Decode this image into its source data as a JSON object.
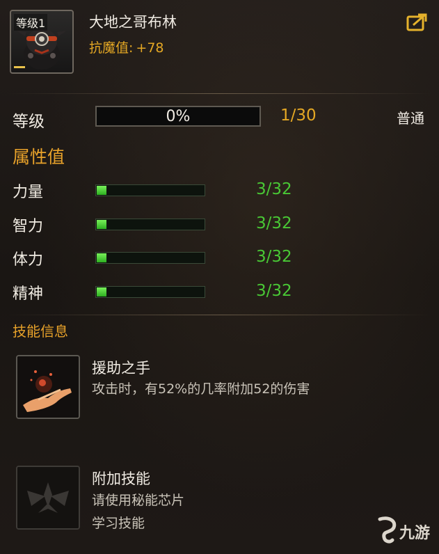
{
  "header": {
    "level_tag": "等级1",
    "name": "大地之哥布林",
    "stat_label": "抗魔值:",
    "stat_value": "+78"
  },
  "level": {
    "label": "等级",
    "progress_text": "0%",
    "progress_fraction": 0.0,
    "count": "1/30",
    "quality": "普通"
  },
  "attributes": {
    "title": "属性值",
    "items": [
      {
        "name": "力量",
        "value": "3/32",
        "fraction": 0.094
      },
      {
        "name": "智力",
        "value": "3/32",
        "fraction": 0.094
      },
      {
        "name": "体力",
        "value": "3/32",
        "fraction": 0.094
      },
      {
        "name": "精神",
        "value": "3/32",
        "fraction": 0.094
      }
    ]
  },
  "skills": {
    "title": "技能信息",
    "items": [
      {
        "name": "援助之手",
        "desc_line1": "攻击时，有52%的几率附加52的伤害",
        "icon": "helping-hand-icon"
      },
      {
        "name": "附加技能",
        "desc_line1": "请使用秘能芯片",
        "desc_line2": "学习技能",
        "icon": "empty-skill-emblem-icon"
      }
    ]
  },
  "watermark": {
    "text": "九游"
  },
  "colors": {
    "accent_orange": "#e5a824",
    "attr_green": "#49c835",
    "background": "#1b1715"
  }
}
